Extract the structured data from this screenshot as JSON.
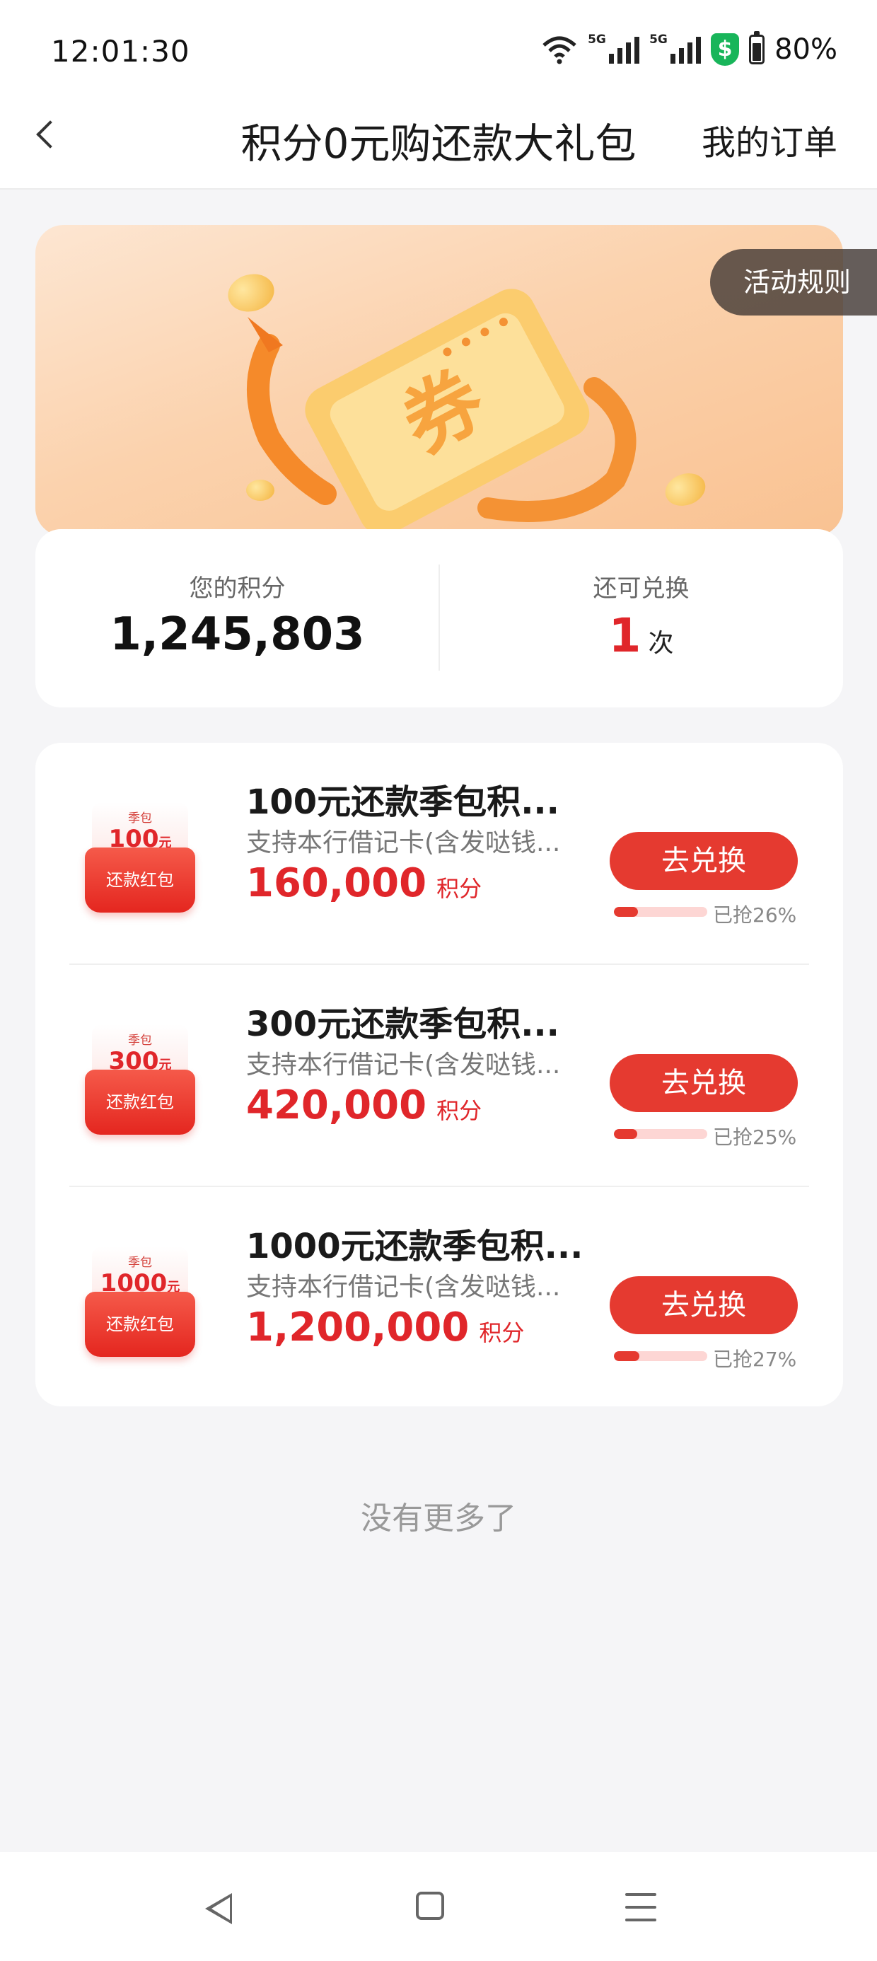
{
  "status_bar": {
    "time": "12:01:30",
    "network1": "5G",
    "network2": "5G",
    "battery": "80%",
    "icons": [
      "wifi-icon",
      "signal-icon",
      "signal-icon",
      "security-shield-icon",
      "battery-icon"
    ]
  },
  "header": {
    "title": "积分0元购还款大礼包",
    "orders": "我的订单",
    "back_icon": "chevron-left-icon"
  },
  "banner": {
    "rules": "活动规则",
    "ticket_char": "券"
  },
  "points": {
    "label": "您的积分",
    "value": "1,245,803",
    "remain_label": "还可兑换",
    "remain_count": "1",
    "remain_unit": "次"
  },
  "items": [
    {
      "badge_top": "季包",
      "badge_amount": "100",
      "badge_yuan": "元",
      "badge_bottom": "还款红包",
      "title": "100元还款季包积...",
      "subtitle": "支持本行借记卡(含发哒钱...",
      "price": "160,000",
      "unit": "积分",
      "button": "去兑换",
      "progress": 0.26,
      "progress_text": "已抢26%"
    },
    {
      "badge_top": "季包",
      "badge_amount": "300",
      "badge_yuan": "元",
      "badge_bottom": "还款红包",
      "title": "300元还款季包积...",
      "subtitle": "支持本行借记卡(含发哒钱...",
      "price": "420,000",
      "unit": "积分",
      "button": "去兑换",
      "progress": 0.25,
      "progress_text": "已抢25%"
    },
    {
      "badge_top": "季包",
      "badge_amount": "1000",
      "badge_yuan": "元",
      "badge_bottom": "还款红包",
      "title": "1000元还款季包积...",
      "subtitle": "支持本行借记卡(含发哒钱...",
      "price": "1,200,000",
      "unit": "积分",
      "button": "去兑换",
      "progress": 0.27,
      "progress_text": "已抢27%"
    }
  ],
  "footer": {
    "no_more": "没有更多了"
  },
  "colors": {
    "accent": "#e53a30",
    "price": "#e0262a",
    "banner": "#fbd2ad"
  }
}
